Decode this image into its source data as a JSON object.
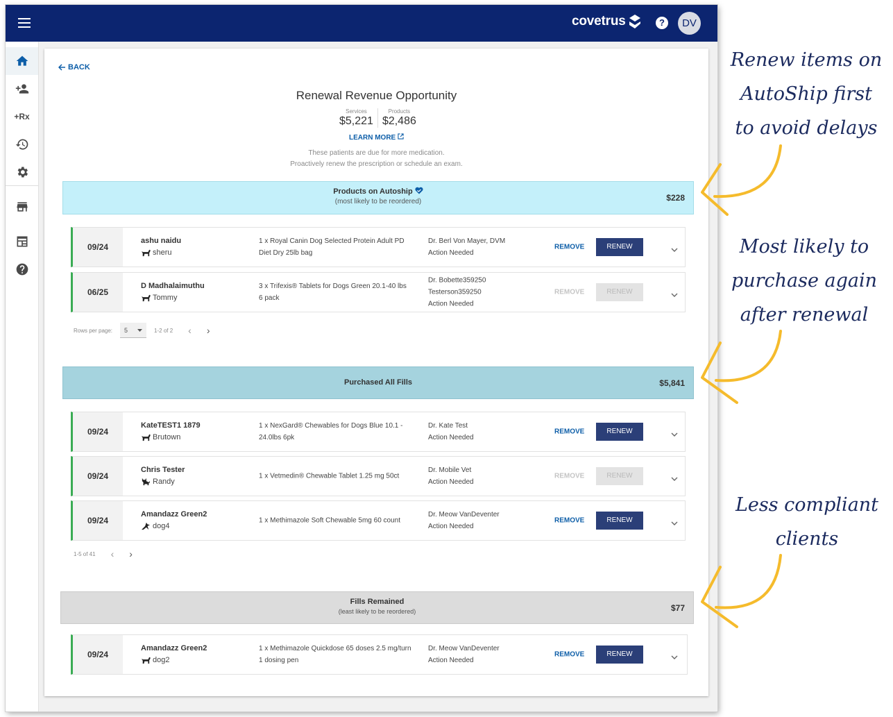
{
  "header": {
    "brand": "covetrus",
    "avatar": "DV",
    "help": "?"
  },
  "sidebar": {
    "rx": "+Rx"
  },
  "page": {
    "back": "BACK",
    "title": "Renewal Revenue Opportunity",
    "stats": [
      {
        "label": "Services",
        "value": "$5,221"
      },
      {
        "label": "Products",
        "value": "$2,486"
      }
    ],
    "learn_more": "LEARN MORE",
    "desc_line1": "These patients are due for more medication.",
    "desc_line2": "Proactively renew the prescription or schedule an exam."
  },
  "sections": [
    {
      "title": "Products on Autoship",
      "subtitle": "(most likely to be reordered)",
      "amount": "$228",
      "rows": [
        {
          "date": "09/24",
          "client": "ashu naidu",
          "pet": "sheru",
          "product": "1 x Royal Canin Dog Selected Protein Adult PD Diet Dry 25lb bag",
          "doctor": "Dr. Berl Von Mayer, DVM",
          "status": "Action Needed",
          "remove": "REMOVE",
          "renew": "RENEW"
        },
        {
          "date": "06/25",
          "client": "D Madhalaimuthu",
          "pet": "Tommy",
          "product": "3 x Trifexis® Tablets for Dogs Green 20.1-40 lbs 6 pack",
          "doctor": "Dr. Bobette359250 Testerson359250",
          "status": "Action Needed",
          "remove": "REMOVE",
          "renew": "RENEW"
        }
      ],
      "pager": {
        "rows_label": "Rows per page:",
        "rows_value": "5",
        "range": "1-2 of 2"
      }
    },
    {
      "title": "Purchased All Fills",
      "amount": "$5,841",
      "rows": [
        {
          "date": "09/24",
          "client": "KateTEST1 1879",
          "pet": "Brutown",
          "product": "1 x NexGard® Chewables for Dogs Blue 10.1 - 24.0lbs 6pk",
          "doctor": "Dr. Kate Test",
          "status": "Action Needed",
          "remove": "REMOVE",
          "renew": "RENEW"
        },
        {
          "date": "09/24",
          "client": "Chris Tester",
          "pet": "Randy",
          "product": "1 x Vetmedin® Chewable Tablet 1.25 mg 50ct",
          "doctor": "Dr. Mobile Vet",
          "status": "Action Needed",
          "remove": "REMOVE",
          "renew": "RENEW"
        },
        {
          "date": "09/24",
          "client": "Amandazz Green2",
          "pet": "dog4",
          "product": "1 x Methimazole Soft Chewable 5mg 60 count",
          "doctor": "Dr. Meow VanDeventer",
          "status": "Action Needed",
          "remove": "REMOVE",
          "renew": "RENEW"
        }
      ],
      "pager": {
        "range": "1-5 of 41"
      }
    },
    {
      "title": "Fills Remained",
      "subtitle": "(least likely to be reordered)",
      "amount": "$77",
      "rows": [
        {
          "date": "09/24",
          "client": "Amandazz Green2",
          "pet": "dog2",
          "product": "1 x Methimazole Quickdose 65 doses 2.5 mg/turn 1 dosing pen",
          "doctor": "Dr. Meow VanDeventer",
          "status": "Action Needed",
          "remove": "REMOVE",
          "renew": "RENEW"
        }
      ]
    }
  ],
  "annotations": [
    {
      "lines": [
        "Renew items on",
        "AutoShip first",
        "to avoid delays"
      ]
    },
    {
      "lines": [
        "Most likely to",
        "purchase again",
        "after renewal"
      ]
    },
    {
      "lines": [
        "Less compliant",
        "clients"
      ]
    }
  ],
  "colors": {
    "nav": "#0c2570",
    "accent": "#0d5ea8",
    "autoship_banner": "#c4f0fa",
    "fills_banner": "#a5d3de",
    "remained_banner": "#dcdcdc",
    "row_status_bar": "#3aac54",
    "annotation_arrow": "#f5bb2c"
  }
}
